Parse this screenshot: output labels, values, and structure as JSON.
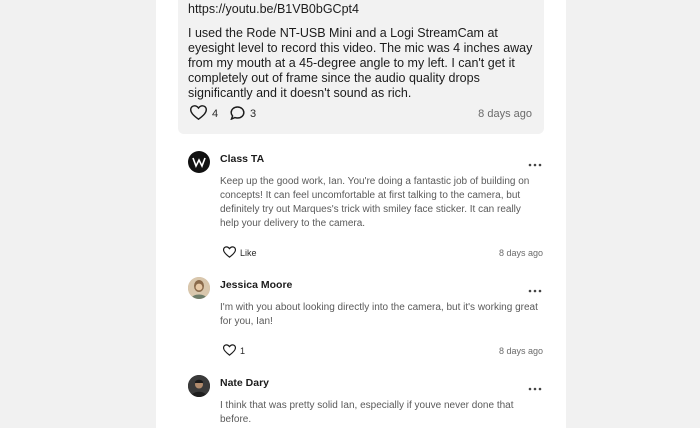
{
  "post": {
    "link": "https://youtu.be/B1VB0bGCpt4",
    "body": "I used the Rode NT-USB Mini and a Logi StreamCam at eyesight level to record this video. The mic was 4 inches away from my mouth at a 45-degree angle to my left. I can't get it completely out of frame since the audio quality drops significantly and it doesn't sound as rich.",
    "like_count": "4",
    "comment_count": "3",
    "time": "8 days ago"
  },
  "comments": [
    {
      "author": "Class TA",
      "text": "Keep up the good work, Ian. You're doing a fantastic job of building on concepts! It can feel uncomfortable at first talking to the camera, but definitely try out Marques's trick with smiley face sticker. It can really help your delivery to the camera.",
      "like_label": "Like",
      "time": "8 days ago"
    },
    {
      "author": "Jessica Moore",
      "text": "I'm with you about looking directly into the camera, but it's working great for you, Ian!",
      "like_label": "1",
      "time": "8 days ago"
    },
    {
      "author": "Nate Dary",
      "text": "I think that was pretty solid Ian, especially if youve never done that before."
    }
  ],
  "icons": {
    "like": "heart-icon",
    "comment": "speech-bubble-icon",
    "more": "more-dots-icon"
  },
  "colors": {
    "background": "#f1f1f1",
    "panel": "#ffffff",
    "post_card": "#f2f2f2",
    "text": "#1c1c1c",
    "muted": "#6b6b6b"
  }
}
